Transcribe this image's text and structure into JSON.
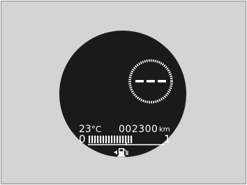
{
  "display": {
    "speed_readout": "---",
    "temperature": {
      "value": "23",
      "unit": "°C"
    },
    "odometer": {
      "value": "002300",
      "unit": "km"
    },
    "fuel_gauge": {
      "empty_label": "0",
      "full_label": "1",
      "level": 0.6,
      "icon": "fuel-pump-icon"
    }
  },
  "colors": {
    "frame_background": "#d4d4d4",
    "dial_background": "#1a1a1a",
    "display_text": "#ffffff"
  }
}
